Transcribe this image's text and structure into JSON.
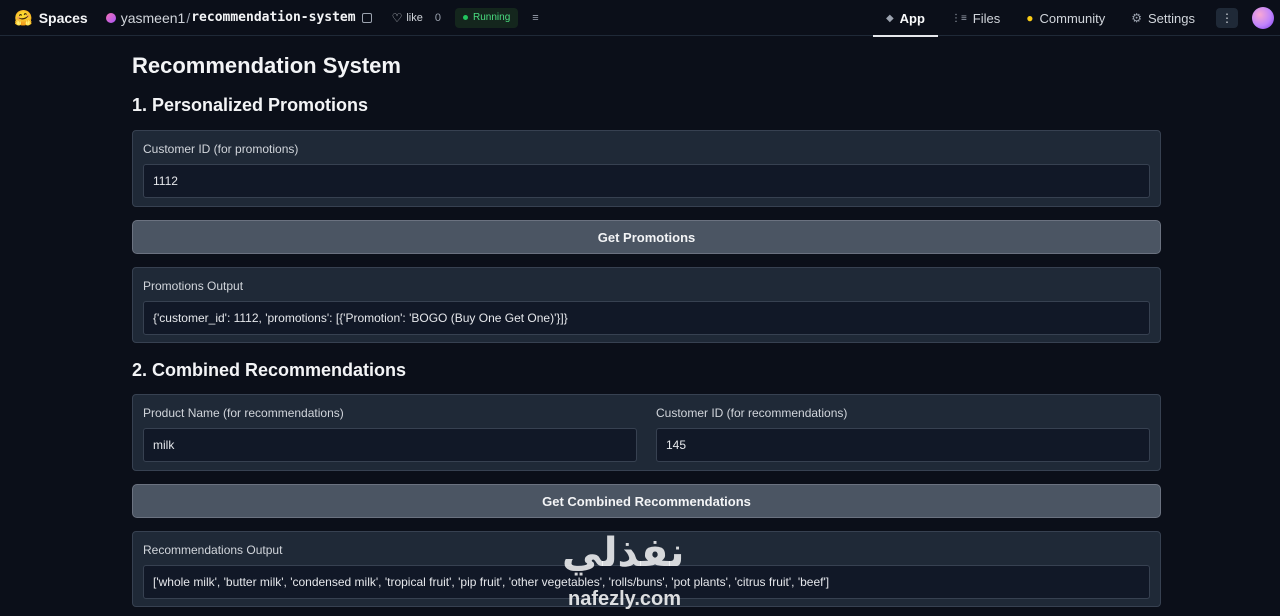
{
  "topbar": {
    "brand": "Spaces",
    "owner": "yasmeen1",
    "separator": "/",
    "repo": "recommendation-system",
    "like_label": "like",
    "like_count": "0",
    "status": "Running",
    "tabs": [
      {
        "label": "App",
        "icon": "cube-icon",
        "active": true
      },
      {
        "label": "Files",
        "icon": "files-icon",
        "active": false
      },
      {
        "label": "Community",
        "icon": "community-icon",
        "active": false
      },
      {
        "label": "Settings",
        "icon": "gear-icon",
        "active": false
      }
    ]
  },
  "main": {
    "title": "Recommendation System",
    "section1": {
      "title": "1. Personalized Promotions",
      "input_label": "Customer ID (for promotions)",
      "input_value": "1112",
      "button_label": "Get Promotions",
      "output_label": "Promotions Output",
      "output_value": "{'customer_id': 1112, 'promotions': [{'Promotion': 'BOGO (Buy One Get One)'}]}"
    },
    "section2": {
      "title": "2. Combined Recommendations",
      "product_label": "Product Name (for recommendations)",
      "product_value": "milk",
      "customer_label": "Customer ID (for recommendations)",
      "customer_value": "145",
      "button_label": "Get Combined Recommendations",
      "output_label": "Recommendations Output",
      "output_value": "['whole milk', 'butter milk', 'condensed milk', 'tropical fruit', 'pip fruit', 'other vegetables', 'rolls/buns', 'pot plants', 'citrus fruit', 'beef']"
    }
  },
  "watermark": {
    "arabic": "نفذلي",
    "latin": "nafezly.com"
  },
  "colors": {
    "background": "#0b0f19",
    "panel": "#1f2937",
    "button": "#4b5563",
    "status": "#22c55e"
  }
}
